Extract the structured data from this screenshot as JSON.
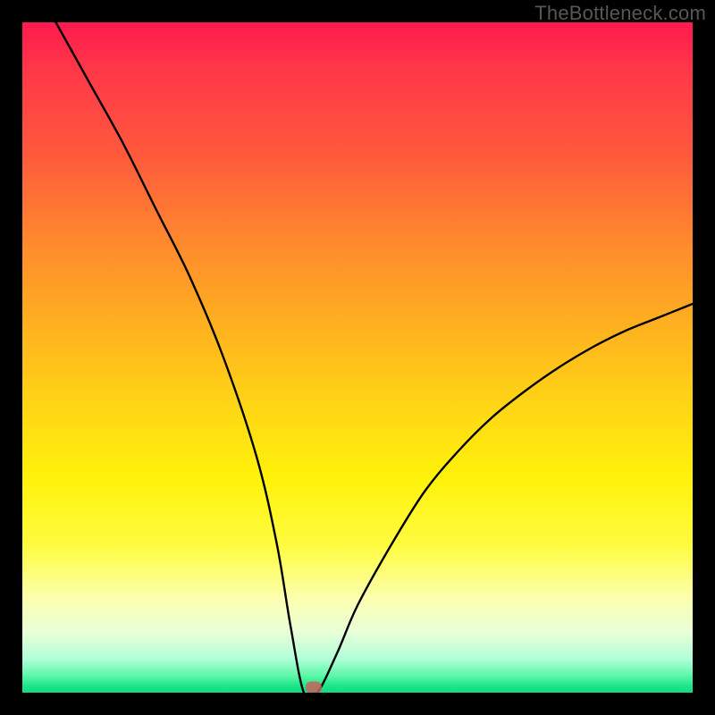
{
  "watermark": "TheBottleneck.com",
  "colors": {
    "frame_bg": "#000000",
    "curve_stroke": "#000000",
    "marker_fill": "#c9645a",
    "gradient_top": "#ff1a4e",
    "gradient_bottom": "#15d97f"
  },
  "chart_data": {
    "type": "line",
    "title": "",
    "xlabel": "",
    "ylabel": "",
    "xlim": [
      0,
      100
    ],
    "ylim": [
      0,
      100
    ],
    "grid": false,
    "legend": false,
    "notes": "V-shaped bottleneck curve over a vertical red→green gradient. Minimum near x≈42, y≈0. Left branch starts near top-left corner; right branch exits right edge at ~55% height.",
    "series": [
      {
        "name": "bottleneck-curve",
        "x": [
          5,
          10,
          15,
          20,
          25,
          30,
          35,
          38,
          40,
          42,
          44,
          47,
          50,
          55,
          60,
          65,
          70,
          75,
          80,
          85,
          90,
          95,
          100
        ],
        "y": [
          100,
          91,
          82,
          72,
          62,
          50,
          35,
          22,
          10,
          0,
          0,
          6,
          13,
          22,
          30,
          36,
          41,
          45,
          48.5,
          51.5,
          54,
          56,
          58
        ]
      }
    ],
    "marker": {
      "x": 43.5,
      "y": 0.8
    }
  }
}
